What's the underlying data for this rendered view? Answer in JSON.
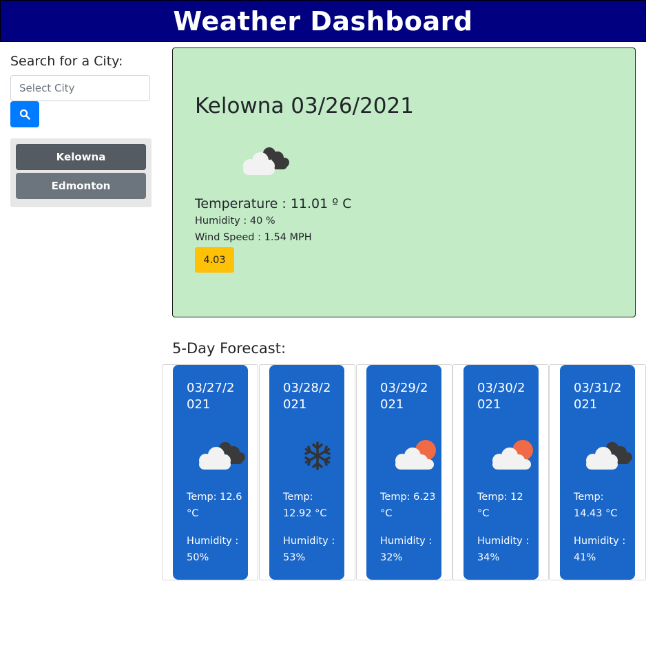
{
  "header": {
    "title": "Weather Dashboard"
  },
  "search": {
    "label": "Search for a City:",
    "placeholder": "Select City",
    "button_icon": "search-icon"
  },
  "history": {
    "items": [
      {
        "label": "Kelowna"
      },
      {
        "label": "Edmonton"
      }
    ]
  },
  "current": {
    "title": "Kelowna 03/26/2021",
    "icon": "partly-cloudy-night-icon",
    "temperature": "Temperature : 11.01 º C",
    "humidity": "Humidity : 40 %",
    "wind": "Wind Speed : 1.54 MPH",
    "uv_index": "4.03",
    "uv_color": "#ffc107"
  },
  "forecast": {
    "title": "5-Day Forecast:",
    "days": [
      {
        "date": "03/27/2021",
        "icon": "clouds-night-icon",
        "temp": "Temp: 12.6 °C",
        "humidity": "Humidity : 50%"
      },
      {
        "date": "03/28/2021",
        "icon": "snow-icon",
        "temp": "Temp: 12.92 °C",
        "humidity": "Humidity : 53%"
      },
      {
        "date": "03/29/2021",
        "icon": "partly-sunny-icon",
        "temp": "Temp: 6.23 °C",
        "humidity": "Humidity : 32%"
      },
      {
        "date": "03/30/2021",
        "icon": "partly-sunny-icon",
        "temp": "Temp: 12 °C",
        "humidity": "Humidity : 34%"
      },
      {
        "date": "03/31/2021",
        "icon": "clouds-night-icon",
        "temp": "Temp: 14.43 °C",
        "humidity": "Humidity : 41%"
      }
    ]
  },
  "colors": {
    "header_bg": "#000080",
    "current_bg": "#c3ebc6",
    "forecast_bg": "#1a66c9",
    "search_button": "#007bff"
  }
}
